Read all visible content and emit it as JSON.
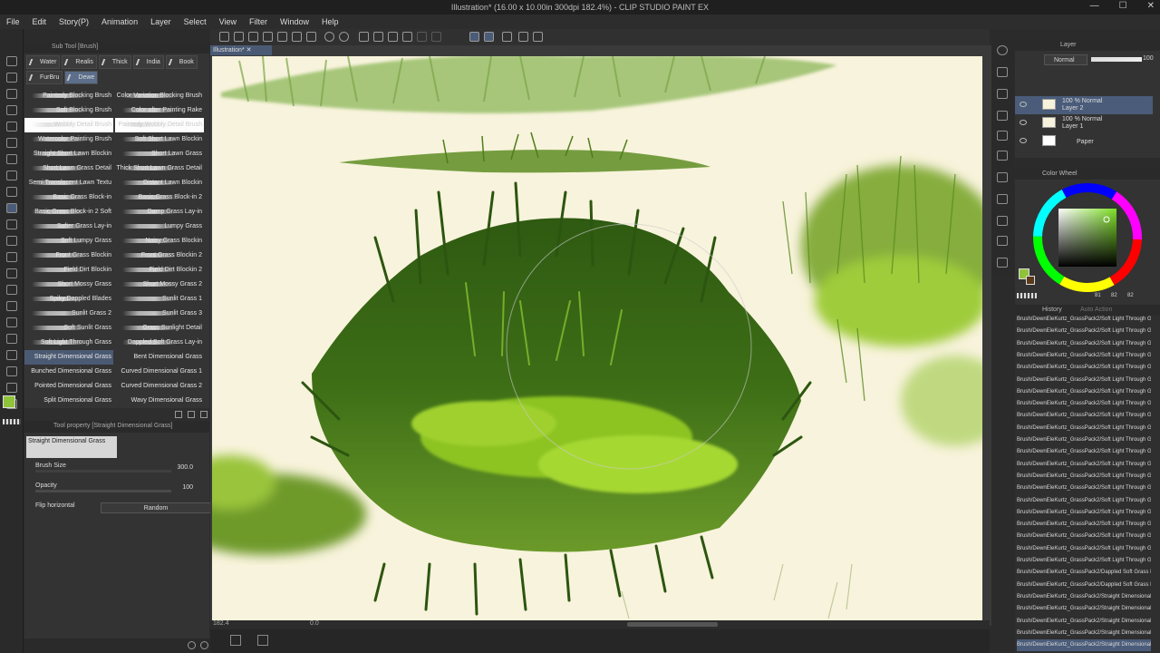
{
  "window": {
    "title": "Illustration* (16.00 x 10.00in 300dpi 182.4%) - CLIP STUDIO PAINT EX",
    "controls": [
      "—",
      "☐",
      "✕"
    ]
  },
  "menu": [
    "File",
    "Edit",
    "Story(P)",
    "Animation",
    "Layer",
    "Select",
    "View",
    "Filter",
    "Window",
    "Help"
  ],
  "subtool": {
    "title": "Sub Tool [Brush]",
    "tabs": [
      "Water",
      "Realis",
      "Thick",
      "India",
      "Book",
      "FurBru",
      "Dewe"
    ],
    "brushes": [
      [
        "Painterly Blocking Brush",
        "Color Variation Blocking Brush"
      ],
      [
        "Soft Blocking Brush",
        "Color after Painting Rake"
      ],
      [
        "Wobbly Detail Brush",
        "Painterly Wobbly Detail Brush"
      ],
      [
        "Watercolor Painting Brush",
        "Soft Short Lawn Blockin"
      ],
      [
        "Straight Short Lawn Blockin",
        "Short Lawn Grass"
      ],
      [
        "Short Lawn Grass Detail",
        "Thick Short Lawn Grass Detail"
      ],
      [
        "Semi Translucent Lawn Textu",
        "Distant Lawn Blockin"
      ],
      [
        "Basic Grass Block-in",
        "Basic Grass Block-in 2"
      ],
      [
        "Basic Grass Block-in 2 Soft",
        "Damp Grass Lay-in"
      ],
      [
        "Softer Grass Lay-in",
        "Lumpy Grass"
      ],
      [
        "Soft Lumpy Grass",
        "Noisy Grass Blockin"
      ],
      [
        "Front Grass Blockin",
        "Front Grass Blockin 2"
      ],
      [
        "Field Dirt Blockin",
        "Field Dirt Blockin 2"
      ],
      [
        "Short Mossy Grass",
        "Short Mossy Grass 2"
      ],
      [
        "Spiky Dappled Blades",
        "Sunlit Grass 1"
      ],
      [
        "Sunlit Grass 2",
        "Sunlit Grass 3"
      ],
      [
        "Soft Sunlit Grass",
        "Grass Sunlight Detail"
      ],
      [
        "Soft Light Through Grass",
        "Dappled Soft Grass Lay-in"
      ],
      [
        "Straight Dimensional Grass",
        "Bent Dimensional Grass"
      ],
      [
        "Bunched Dimensional Grass",
        "Curved Dimensional Grass 1"
      ],
      [
        "Pointed Dimensional Grass",
        "Curved Dimensional Grass 2"
      ],
      [
        "Split Dimensional Grass",
        "Wavy Dimensional Grass"
      ]
    ]
  },
  "toolprop": {
    "title": "Tool property [Straight Dimensional Grass]",
    "preview_label": "Straight Dimensional Grass",
    "brush_size_label": "Brush Size",
    "brush_size_value": "300.0",
    "opacity_label": "Opacity",
    "opacity_value": "100",
    "flip_label": "Flip horizontal",
    "flip_value": "Random"
  },
  "canvas": {
    "tab": "Illustration*",
    "zoom": "182.4",
    "angle": "0.0"
  },
  "layers": {
    "title": "Layer",
    "blend_mode": "Normal",
    "opacity": "100",
    "rows": [
      {
        "line1": "100 % Normal",
        "line2": "Layer 2",
        "selected": true
      },
      {
        "line1": "100 % Normal",
        "line2": "Layer 1",
        "selected": false
      },
      {
        "line1": "",
        "line2": "Paper",
        "selected": false
      }
    ]
  },
  "color": {
    "title": "Color Wheel",
    "current": "#8fc43a",
    "secondary": "#5a3a1a",
    "values": [
      "81",
      "82",
      "82"
    ]
  },
  "history": {
    "title": "History",
    "tab2": "Auto Action",
    "items": [
      "Brush/DewnEleKurtz_GrassPack2/Soft Light Through Grass",
      "Brush/DewnEleKurtz_GrassPack2/Soft Light Through Grass",
      "Brush/DewnEleKurtz_GrassPack2/Soft Light Through Grass",
      "Brush/DewnEleKurtz_GrassPack2/Soft Light Through Grass",
      "Brush/DewnEleKurtz_GrassPack2/Soft Light Through Grass",
      "Brush/DewnEleKurtz_GrassPack2/Soft Light Through Grass",
      "Brush/DewnEleKurtz_GrassPack2/Soft Light Through Grass",
      "Brush/DewnEleKurtz_GrassPack2/Soft Light Through Grass",
      "Brush/DewnEleKurtz_GrassPack2/Soft Light Through Grass",
      "Brush/DewnEleKurtz_GrassPack2/Soft Light Through Grass",
      "Brush/DewnEleKurtz_GrassPack2/Soft Light Through Grass",
      "Brush/DewnEleKurtz_GrassPack2/Soft Light Through Grass",
      "Brush/DewnEleKurtz_GrassPack2/Soft Light Through Grass",
      "Brush/DewnEleKurtz_GrassPack2/Soft Light Through Grass",
      "Brush/DewnEleKurtz_GrassPack2/Soft Light Through Grass",
      "Brush/DewnEleKurtz_GrassPack2/Soft Light Through Grass",
      "Brush/DewnEleKurtz_GrassPack2/Soft Light Through Grass",
      "Brush/DewnEleKurtz_GrassPack2/Soft Light Through Grass",
      "Brush/DewnEleKurtz_GrassPack2/Soft Light Through Grass",
      "Brush/DewnEleKurtz_GrassPack2/Soft Light Through Grass",
      "Brush/DewnEleKurtz_GrassPack2/Soft Light Through Grass",
      "Brush/DewnEleKurtz_GrassPack2/Dappled Soft Grass Lay-in",
      "Brush/DewnEleKurtz_GrassPack2/Dappled Soft Grass Lay-in",
      "Brush/DewnEleKurtz_GrassPack2/Straight Dimensional Gra",
      "Brush/DewnEleKurtz_GrassPack2/Straight Dimensional Gra",
      "Brush/DewnEleKurtz_GrassPack2/Straight Dimensional Gra",
      "Brush/DewnEleKurtz_GrassPack2/Straight Dimensional Gra",
      "Brush/DewnEleKurtz_GrassPack2/Straight Dimensional Gra"
    ]
  }
}
